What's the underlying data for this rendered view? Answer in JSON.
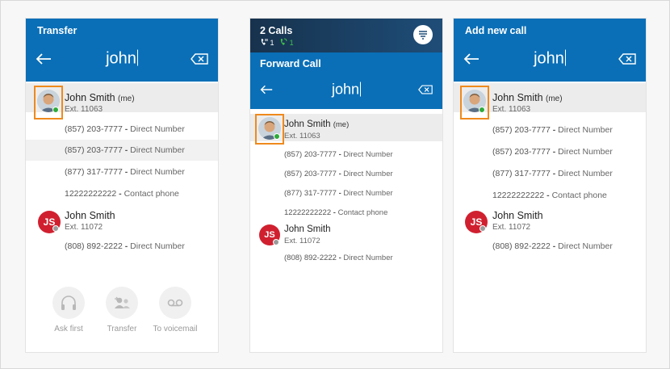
{
  "panels": {
    "transfer": {
      "title": "Transfer",
      "query": "john"
    },
    "forward": {
      "calls_title": "2 Calls",
      "held_count": "1",
      "active_count": "1",
      "title": "Forward Call",
      "query": "john"
    },
    "addcall": {
      "title": "Add new call",
      "query": "john"
    }
  },
  "contacts": {
    "smith_me": {
      "name": "John Smith",
      "me_tag": "(me)",
      "ext": "Ext. 11063",
      "numbers": [
        {
          "number": "(857) 203-7777",
          "label": "Direct Number"
        },
        {
          "number": "(857) 203-7777",
          "label": "Direct Number"
        },
        {
          "number": "(877) 317-7777",
          "label": "Direct Number"
        },
        {
          "number": "12222222222",
          "label": "Contact phone"
        }
      ]
    },
    "smith_js": {
      "initials": "JS",
      "name": "John Smith",
      "ext": "Ext. 11072",
      "numbers": [
        {
          "number": "(808) 892-2222",
          "label": "Direct Number"
        }
      ]
    }
  },
  "separator": "-",
  "actions": {
    "ask_first": "Ask first",
    "transfer": "Transfer",
    "voicemail": "To voicemail"
  },
  "colors": {
    "header_blue": "#0a6fb7",
    "header_dark": "#17324d",
    "highlight_orange": "#ef8a1d",
    "presence_green": "#2eaa3a",
    "initials_red": "#d0202f"
  },
  "icons": {
    "back": "back-arrow-icon",
    "clear": "backspace-clear-icon",
    "hold": "call-hold-icon",
    "active_call": "active-call-icon",
    "call_list": "call-list-icon",
    "ask_first": "headset-icon",
    "transfer": "transfer-users-icon",
    "voicemail": "voicemail-icon"
  }
}
